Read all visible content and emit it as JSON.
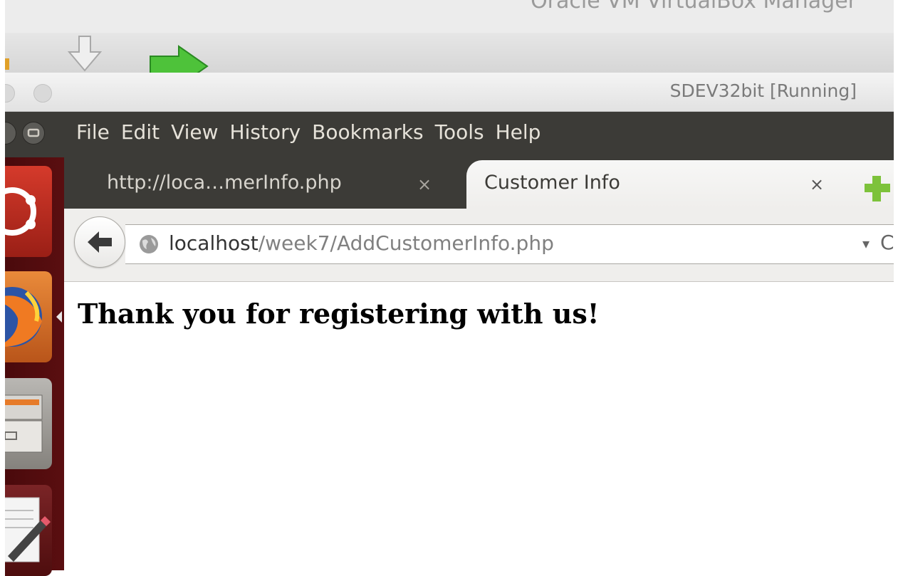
{
  "virtualbox": {
    "title": "Oracle VM VirtualBox Manager"
  },
  "vm_window": {
    "title": "SDEV32bit [Running]"
  },
  "menubar": {
    "items": [
      "File",
      "Edit",
      "View",
      "History",
      "Bookmarks",
      "Tools",
      "Help"
    ]
  },
  "tabs": [
    {
      "title": "http://loca…merInfo.php",
      "close": "×",
      "active": false
    },
    {
      "title": "Customer Info",
      "close": "×",
      "active": true
    }
  ],
  "navbar": {
    "url_host": "localhost",
    "url_path": "/week7/AddCustomerInfo.php",
    "dropdown": "▾",
    "reload": "C"
  },
  "page": {
    "heading": "Thank you for registering with us!"
  },
  "colors": {
    "menubar": "#3c3b37",
    "launcher": "#4a0a0c",
    "new_tab_plus": "#7dc23b"
  },
  "launcher_icons": [
    "ubuntu-dash-icon",
    "firefox-icon",
    "files-icon",
    "text-editor-icon"
  ]
}
